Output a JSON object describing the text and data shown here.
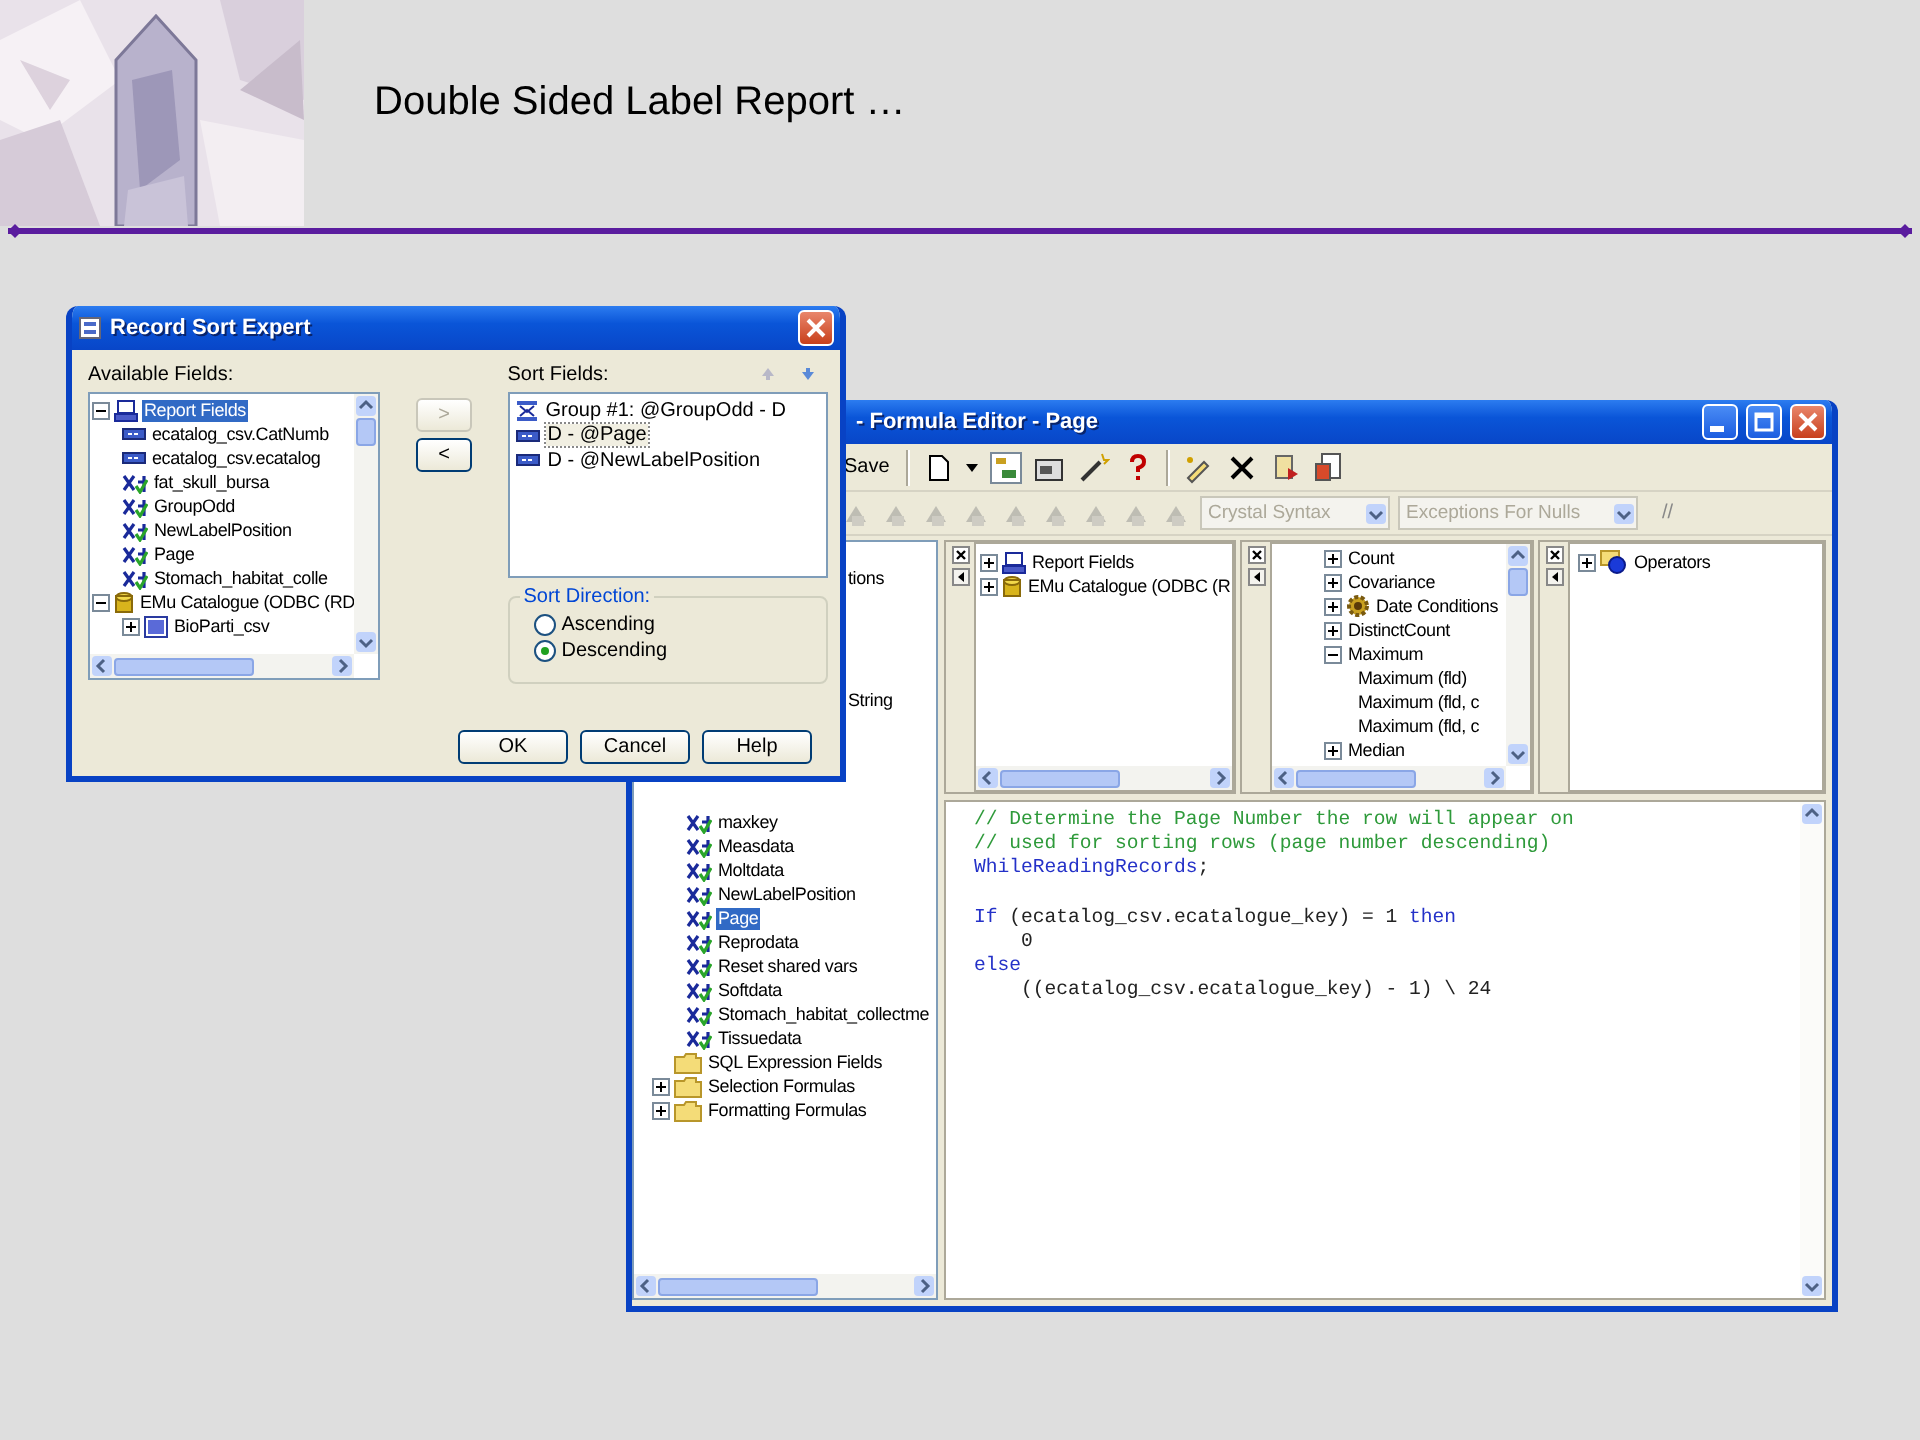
{
  "slide": {
    "title": "Double Sided Label Report …"
  },
  "sort_expert": {
    "title": "Record Sort Expert",
    "available_label": "Available Fields:",
    "available_fields": [
      {
        "label": "Report Fields",
        "kind": "report",
        "expanded": true,
        "selected": true,
        "children": [
          {
            "label": "ecatalog_csv.CatNumb",
            "kind": "field",
            "selected": false
          },
          {
            "label": "ecatalog_csv.ecatalog",
            "kind": "field",
            "selected": false
          },
          {
            "label": "fat_skull_bursa",
            "kind": "formula",
            "selected": false
          },
          {
            "label": "GroupOdd",
            "kind": "formula",
            "selected": false
          },
          {
            "label": "NewLabelPosition",
            "kind": "formula",
            "selected": false
          },
          {
            "label": "Page",
            "kind": "formula",
            "selected": false
          },
          {
            "label": "Stomach_habitat_colle",
            "kind": "formula",
            "selected": false
          }
        ]
      },
      {
        "label": "EMu Catalogue (ODBC (RD",
        "kind": "database",
        "expanded": true,
        "selected": false,
        "children": [
          {
            "label": "BioParti_csv",
            "kind": "table",
            "expanded": false,
            "selected": false
          }
        ]
      }
    ],
    "add_button": {
      "label": ">",
      "disabled": true
    },
    "remove_button": {
      "label": "<",
      "disabled": false
    },
    "sort_label": "Sort Fields:",
    "sort_fields": [
      {
        "label": "Group #1: @GroupOdd - D",
        "kind": "group",
        "selected": false
      },
      {
        "label": "D - @Page",
        "kind": "field",
        "selected": true
      },
      {
        "label": "D - @NewLabelPosition",
        "kind": "field",
        "selected": false
      }
    ],
    "direction_label": "Sort Direction:",
    "directions": [
      {
        "label": "Ascending",
        "selected": false
      },
      {
        "label": "Descending",
        "selected": true
      }
    ],
    "buttons": [
      "OK",
      "Cancel",
      "Help"
    ]
  },
  "formula_editor": {
    "title": "- Formula Editor - Page",
    "save_label": "Save",
    "syntax": "Crystal Syntax",
    "null_handling": "Exceptions For Nulls",
    "comment_button": "//",
    "workshop_tree": [
      {
        "label": "tions",
        "kind": "partial"
      },
      {
        "label": "String",
        "kind": "partial"
      },
      {
        "label": "maxkey",
        "kind": "formula",
        "selected": false
      },
      {
        "label": "Measdata",
        "kind": "formula",
        "selected": false
      },
      {
        "label": "Moltdata",
        "kind": "formula",
        "selected": false
      },
      {
        "label": "NewLabelPosition",
        "kind": "formula",
        "selected": false
      },
      {
        "label": "Page",
        "kind": "formula",
        "selected": true
      },
      {
        "label": "Reprodata",
        "kind": "formula",
        "selected": false
      },
      {
        "label": "Reset shared vars",
        "kind": "formula",
        "selected": false
      },
      {
        "label": "Softdata",
        "kind": "formula",
        "selected": false
      },
      {
        "label": "Stomach_habitat_collectme",
        "kind": "formula",
        "selected": false
      },
      {
        "label": "Tissuedata",
        "kind": "formula",
        "selected": false
      },
      {
        "label": "SQL Expression Fields",
        "kind": "folder"
      },
      {
        "label": "Selection Formulas",
        "kind": "folder",
        "expanded": false
      },
      {
        "label": "Formatting Formulas",
        "kind": "folder",
        "expanded": false
      }
    ],
    "field_tree": [
      {
        "label": "Report Fields",
        "kind": "report",
        "expanded": false
      },
      {
        "label": "EMu Catalogue (ODBC (R",
        "kind": "database",
        "expanded": false
      }
    ],
    "function_tree": [
      {
        "label": "Count",
        "kind": "function",
        "expanded": false
      },
      {
        "label": "Covariance",
        "kind": "function",
        "expanded": false
      },
      {
        "label": "Date Conditions",
        "kind": "gear",
        "expanded": false
      },
      {
        "label": "DistinctCount",
        "kind": "function",
        "expanded": false
      },
      {
        "label": "Maximum",
        "kind": "function",
        "expanded": true,
        "children": [
          {
            "label": "Maximum (fld)"
          },
          {
            "label": "Maximum (fld, c"
          },
          {
            "label": "Maximum (fld, c"
          }
        ]
      },
      {
        "label": "Median",
        "kind": "function",
        "expanded": false
      }
    ],
    "operator_tree": [
      {
        "label": "Operators",
        "kind": "operators",
        "expanded": false
      }
    ],
    "code": [
      [
        [
          {
            "kind": "comment",
            "text": "// Determine the Page Number the row will appear on"
          }
        ],
        [
          {
            "kind": "comment",
            "text": "// used for sorting rows (page number descending)"
          }
        ],
        [
          {
            "kind": "keyword",
            "text": "WhileReadingRecords"
          },
          {
            "kind": "plain",
            "text": ";"
          }
        ]
      ],
      [
        [
          {
            "kind": "keyword",
            "text": "If"
          },
          {
            "kind": "plain",
            "text": " (ecatalog_csv.ecatalogue_key) = 1 "
          },
          {
            "kind": "keyword",
            "text": "then"
          }
        ],
        [
          {
            "kind": "plain",
            "text": "    0"
          }
        ],
        [
          {
            "kind": "keyword",
            "text": "else"
          }
        ],
        [
          {
            "kind": "plain",
            "text": "    ((ecatalog_csv.ecatalogue_key) - 1) \\ 24"
          }
        ]
      ]
    ]
  }
}
